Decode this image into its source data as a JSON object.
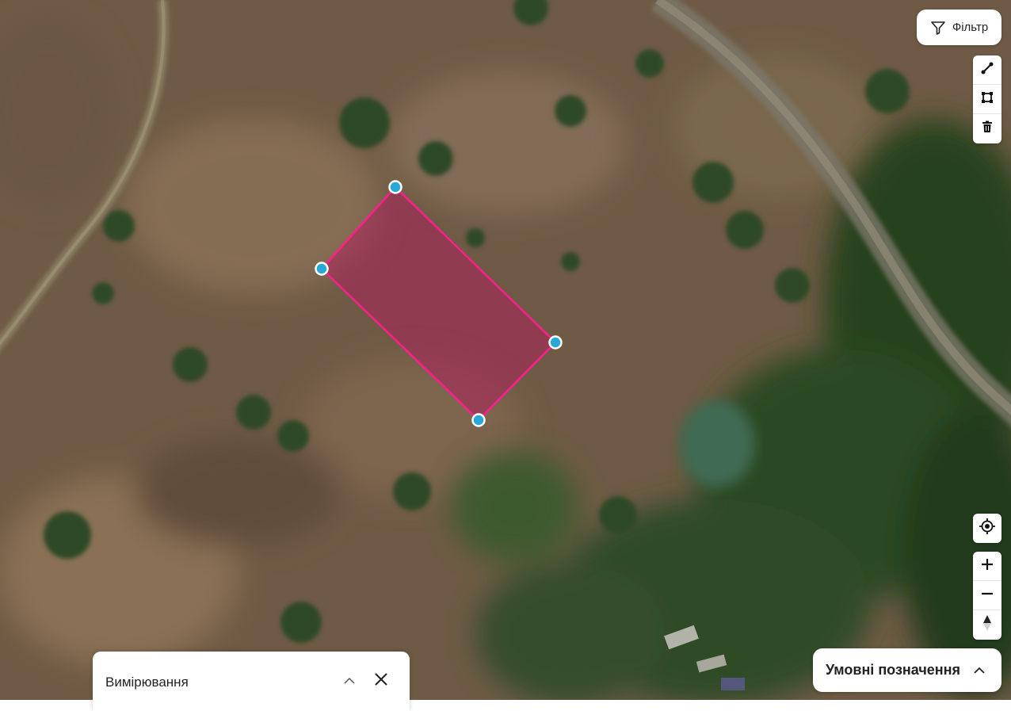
{
  "filter": {
    "label": "Фільтр",
    "icon": "filter-icon"
  },
  "draw_tools": [
    {
      "name": "line-tool",
      "icon": "line-draw-icon"
    },
    {
      "name": "polygon-tool",
      "icon": "polygon-draw-icon"
    },
    {
      "name": "delete-tool",
      "icon": "trash-icon"
    }
  ],
  "map_controls": {
    "locate_icon": "crosshair-icon",
    "zoom_in_icon": "plus-icon",
    "zoom_out_icon": "minus-icon",
    "compass_icon": "compass-icon"
  },
  "measurement_panel": {
    "title": "Вимірювання",
    "collapse_icon": "chevron-up-icon",
    "close_icon": "close-icon"
  },
  "legend": {
    "title": "Умовні позначення",
    "icon": "chevron-up-icon"
  },
  "colors": {
    "polygon_stroke": "#ff1f8e",
    "polygon_fill": "#b8145e",
    "vertex_fill": "#27a8d6"
  }
}
